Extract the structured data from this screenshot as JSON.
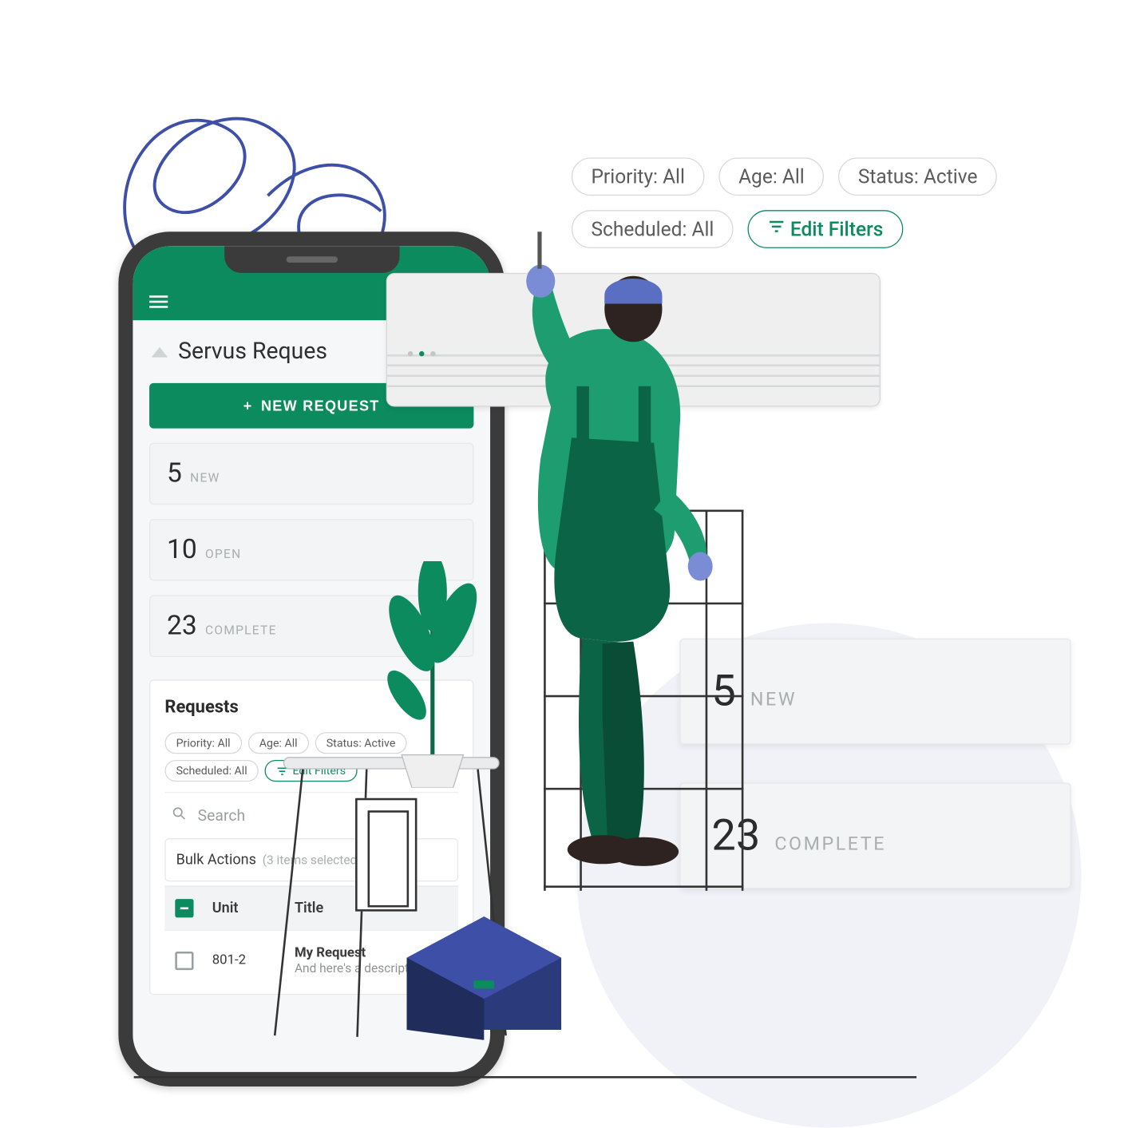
{
  "header": {
    "title": "Servus Reques"
  },
  "new_request_label": "NEW REQUEST",
  "stats": {
    "new": {
      "value": "5",
      "label": "NEW"
    },
    "open": {
      "value": "10",
      "label": "OPEN"
    },
    "complete": {
      "value": "23",
      "label": "COMPLETE"
    }
  },
  "requests": {
    "heading": "Requests",
    "filters": {
      "priority": "Priority: All",
      "age": "Age: All",
      "status": "Status: Active",
      "scheduled": "Scheduled: All",
      "edit": "Edit Filters"
    },
    "search_placeholder": "Search",
    "bulk_label": "Bulk Actions",
    "bulk_sub": "(3 items selected)",
    "columns": {
      "unit": "Unit",
      "title": "Title"
    },
    "row": {
      "unit": "801-2",
      "title": "My Request",
      "desc": "And here's a descripti"
    }
  },
  "callouts": {
    "priority": "Priority: All",
    "age": "Age: All",
    "status": "Status: Active",
    "scheduled": "Scheduled: All",
    "edit": "Edit Filters"
  },
  "big_stats": {
    "new": {
      "value": "5",
      "label": "NEW"
    },
    "complete": {
      "value": "23",
      "label": "COMPLETE"
    }
  },
  "colors": {
    "accent": "#0c8b5e"
  }
}
